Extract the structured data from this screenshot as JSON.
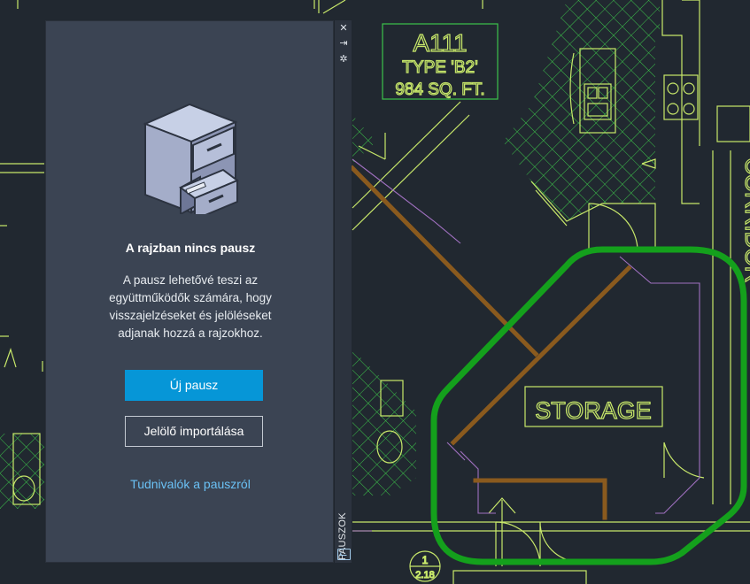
{
  "drawing": {
    "unit_name": "A111",
    "unit_type": "TYPE 'B2'",
    "unit_area": "984 SQ. FT.",
    "room_label": "STORAGE",
    "corridor_label": "CORRIDOR",
    "callout_number": "1",
    "callout_sheet": "2.18",
    "colors": {
      "background": "#212830",
      "walls": "#c8e86a",
      "hatch": "#3cc34a",
      "markup": "#14a01c",
      "beam": "#8a5a1e",
      "dim": "#a070c0"
    }
  },
  "panel": {
    "empty_title": "A rajzban nincs pausz",
    "empty_description": "A pausz lehetővé teszi az együttműködők számára, hogy visszajelzéseket és jelöléseket adjanak hozzá a rajzokhoz.",
    "new_trace_button": "Új pausz",
    "import_markup_button": "Jelölő importálása",
    "learn_link": "Tudnivalók a pauszról",
    "illustration_icon": "file-cabinet-icon"
  },
  "rail": {
    "label": "PAUSZOK",
    "close_icon": "close-icon",
    "autohide_icon": "pin-icon",
    "settings_icon": "gear-icon",
    "traces_icon": "traces-icon"
  }
}
